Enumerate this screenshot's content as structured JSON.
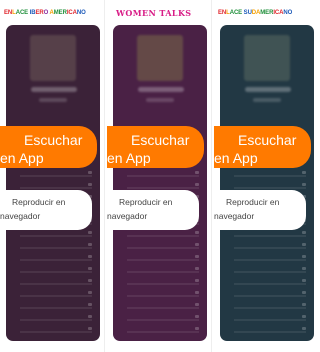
{
  "players": [
    {
      "logo_text": "ENLACE IBERO AMERICANO",
      "logo_parts": [
        {
          "text": "EN",
          "color": "#e0262d"
        },
        {
          "text": "L",
          "color": "#f5a000"
        },
        {
          "text": "ACE",
          "color": "#1f8f3a"
        },
        {
          "text": " IB",
          "color": "#1a58b8"
        },
        {
          "text": "ER",
          "color": "#e0262d"
        },
        {
          "text": "O",
          "color": "#8a2ea0"
        },
        {
          "text": " A",
          "color": "#f5a000"
        },
        {
          "text": "MER",
          "color": "#1f8f3a"
        },
        {
          "text": "ICA",
          "color": "#e0262d"
        },
        {
          "text": "NO",
          "color": "#1a58b8"
        }
      ],
      "card_color": "#3b2238",
      "art_color": "#6d5a58",
      "listen_line1": "Escuchar",
      "listen_line2": "en App",
      "browser_line1": "Reproducir en",
      "browser_line2": "navegador"
    },
    {
      "logo_text": "WOMEN TALKS",
      "logo_parts": [
        {
          "text": "WOMEN TALKS",
          "color": "#d81b86"
        }
      ],
      "card_color": "#4a2145",
      "art_color": "#7a6a4a",
      "listen_line1": "Escuchar",
      "listen_line2": "en App",
      "browser_line1": "Reproducir en",
      "browser_line2": "navegador"
    },
    {
      "logo_text": "ENLACE SUDAMERICANO",
      "logo_parts": [
        {
          "text": "EN",
          "color": "#e0262d"
        },
        {
          "text": "L",
          "color": "#f5a000"
        },
        {
          "text": "ACE",
          "color": "#1f8f3a"
        },
        {
          "text": " SU",
          "color": "#1a58b8"
        },
        {
          "text": "DA",
          "color": "#f5a000"
        },
        {
          "text": "MER",
          "color": "#1f8f3a"
        },
        {
          "text": "ICA",
          "color": "#e0262d"
        },
        {
          "text": "NO",
          "color": "#1a58b8"
        }
      ],
      "card_color": "#223844",
      "art_color": "#5a6a62",
      "listen_line1": "Escuchar",
      "listen_line2": "en App",
      "browser_line1": "Reproducir en",
      "browser_line2": "navegador"
    }
  ],
  "colors": {
    "accent": "#ff7a00",
    "button_text": "#ffffff",
    "secondary_button_bg": "#ffffff",
    "secondary_button_text": "#444444"
  }
}
